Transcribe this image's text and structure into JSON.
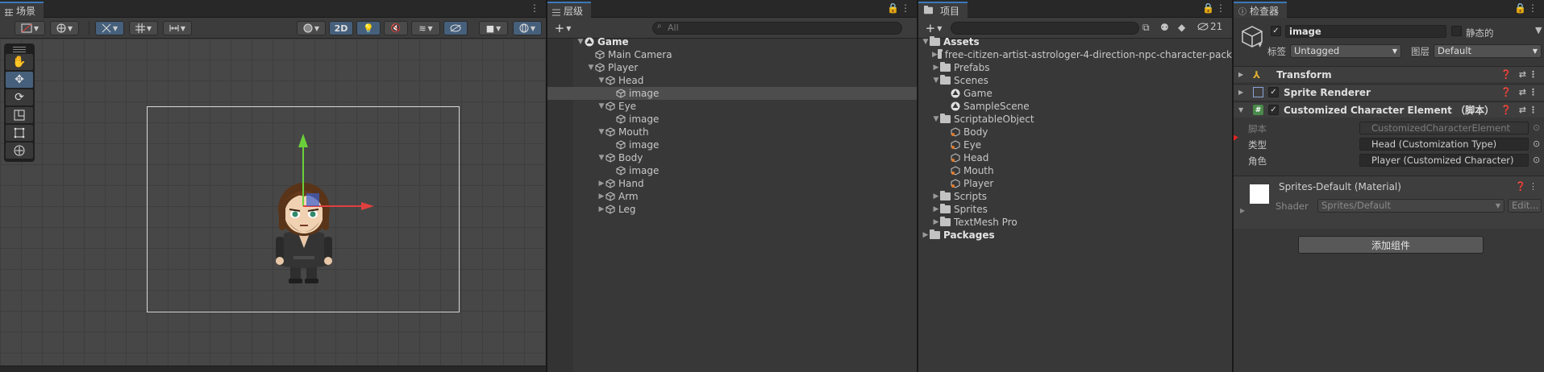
{
  "scene": {
    "tab_label": "场景",
    "btn_2d": "2D"
  },
  "hierarchy": {
    "tab_label": "层级",
    "search_placeholder": "All",
    "items": [
      {
        "label": "Game",
        "depth": 0,
        "arrow": "▼",
        "kind": "scene",
        "bold": true
      },
      {
        "label": "Main Camera",
        "depth": 1,
        "arrow": "",
        "kind": "cube"
      },
      {
        "label": "Player",
        "depth": 1,
        "arrow": "▼",
        "kind": "cube"
      },
      {
        "label": "Head",
        "depth": 2,
        "arrow": "▼",
        "kind": "cube"
      },
      {
        "label": "image",
        "depth": 3,
        "arrow": "",
        "kind": "cube",
        "selected": true
      },
      {
        "label": "Eye",
        "depth": 2,
        "arrow": "▼",
        "kind": "cube"
      },
      {
        "label": "image",
        "depth": 3,
        "arrow": "",
        "kind": "cube"
      },
      {
        "label": "Mouth",
        "depth": 2,
        "arrow": "▼",
        "kind": "cube"
      },
      {
        "label": "image",
        "depth": 3,
        "arrow": "",
        "kind": "cube"
      },
      {
        "label": "Body",
        "depth": 2,
        "arrow": "▼",
        "kind": "cube"
      },
      {
        "label": "image",
        "depth": 3,
        "arrow": "",
        "kind": "cube"
      },
      {
        "label": "Hand",
        "depth": 2,
        "arrow": "▶",
        "kind": "cube"
      },
      {
        "label": "Arm",
        "depth": 2,
        "arrow": "▶",
        "kind": "cube"
      },
      {
        "label": "Leg",
        "depth": 2,
        "arrow": "▶",
        "kind": "cube"
      }
    ]
  },
  "project": {
    "tab_label": "项目",
    "hidden_count": "21",
    "items": [
      {
        "label": "Assets",
        "depth": 0,
        "arrow": "▼",
        "kind": "folder",
        "bold": true
      },
      {
        "label": "free-citizen-artist-astrologer-4-direction-npc-character-pack",
        "depth": 1,
        "arrow": "▶",
        "kind": "folder"
      },
      {
        "label": "Prefabs",
        "depth": 1,
        "arrow": "▶",
        "kind": "folder"
      },
      {
        "label": "Scenes",
        "depth": 1,
        "arrow": "▼",
        "kind": "folder"
      },
      {
        "label": "Game",
        "depth": 2,
        "arrow": "",
        "kind": "scene"
      },
      {
        "label": "SampleScene",
        "depth": 2,
        "arrow": "",
        "kind": "scene"
      },
      {
        "label": "ScriptableObject",
        "depth": 1,
        "arrow": "▼",
        "kind": "folder"
      },
      {
        "label": "Body",
        "depth": 2,
        "arrow": "",
        "kind": "so"
      },
      {
        "label": "Eye",
        "depth": 2,
        "arrow": "",
        "kind": "so"
      },
      {
        "label": "Head",
        "depth": 2,
        "arrow": "",
        "kind": "so"
      },
      {
        "label": "Mouth",
        "depth": 2,
        "arrow": "",
        "kind": "so"
      },
      {
        "label": "Player",
        "depth": 2,
        "arrow": "",
        "kind": "so"
      },
      {
        "label": "Scripts",
        "depth": 1,
        "arrow": "▶",
        "kind": "folder"
      },
      {
        "label": "Sprites",
        "depth": 1,
        "arrow": "▶",
        "kind": "folder"
      },
      {
        "label": "TextMesh Pro",
        "depth": 1,
        "arrow": "▶",
        "kind": "folder"
      },
      {
        "label": "Packages",
        "depth": 0,
        "arrow": "▶",
        "kind": "folder",
        "bold": true
      }
    ]
  },
  "inspector": {
    "tab_label": "检查器",
    "object_name": "image",
    "static_label": "静态的",
    "tag_label": "标签",
    "tag_value": "Untagged",
    "layer_label": "图层",
    "layer_value": "Default",
    "comp_transform": "Transform",
    "comp_sprite_renderer": "Sprite Renderer",
    "comp_custom": "Customized Character Element （脚本）",
    "script_label": "脚本",
    "script_value": "CustomizedCharacterElement",
    "type_label": "类型",
    "type_value": "Head (Customization Type)",
    "role_label": "角色",
    "role_value": "Player (Customized Character)",
    "material_name": "Sprites-Default (Material)",
    "shader_label": "Shader",
    "shader_value": "Sprites/Default",
    "edit_label": "Edit...",
    "add_component": "添加组件"
  },
  "colors": {
    "accent_blue": "#3a79bb",
    "selection": "#4d4d4d",
    "red_annotation": "#e22424",
    "gizmo_green": "#6ad03a",
    "gizmo_red": "#e04040"
  }
}
